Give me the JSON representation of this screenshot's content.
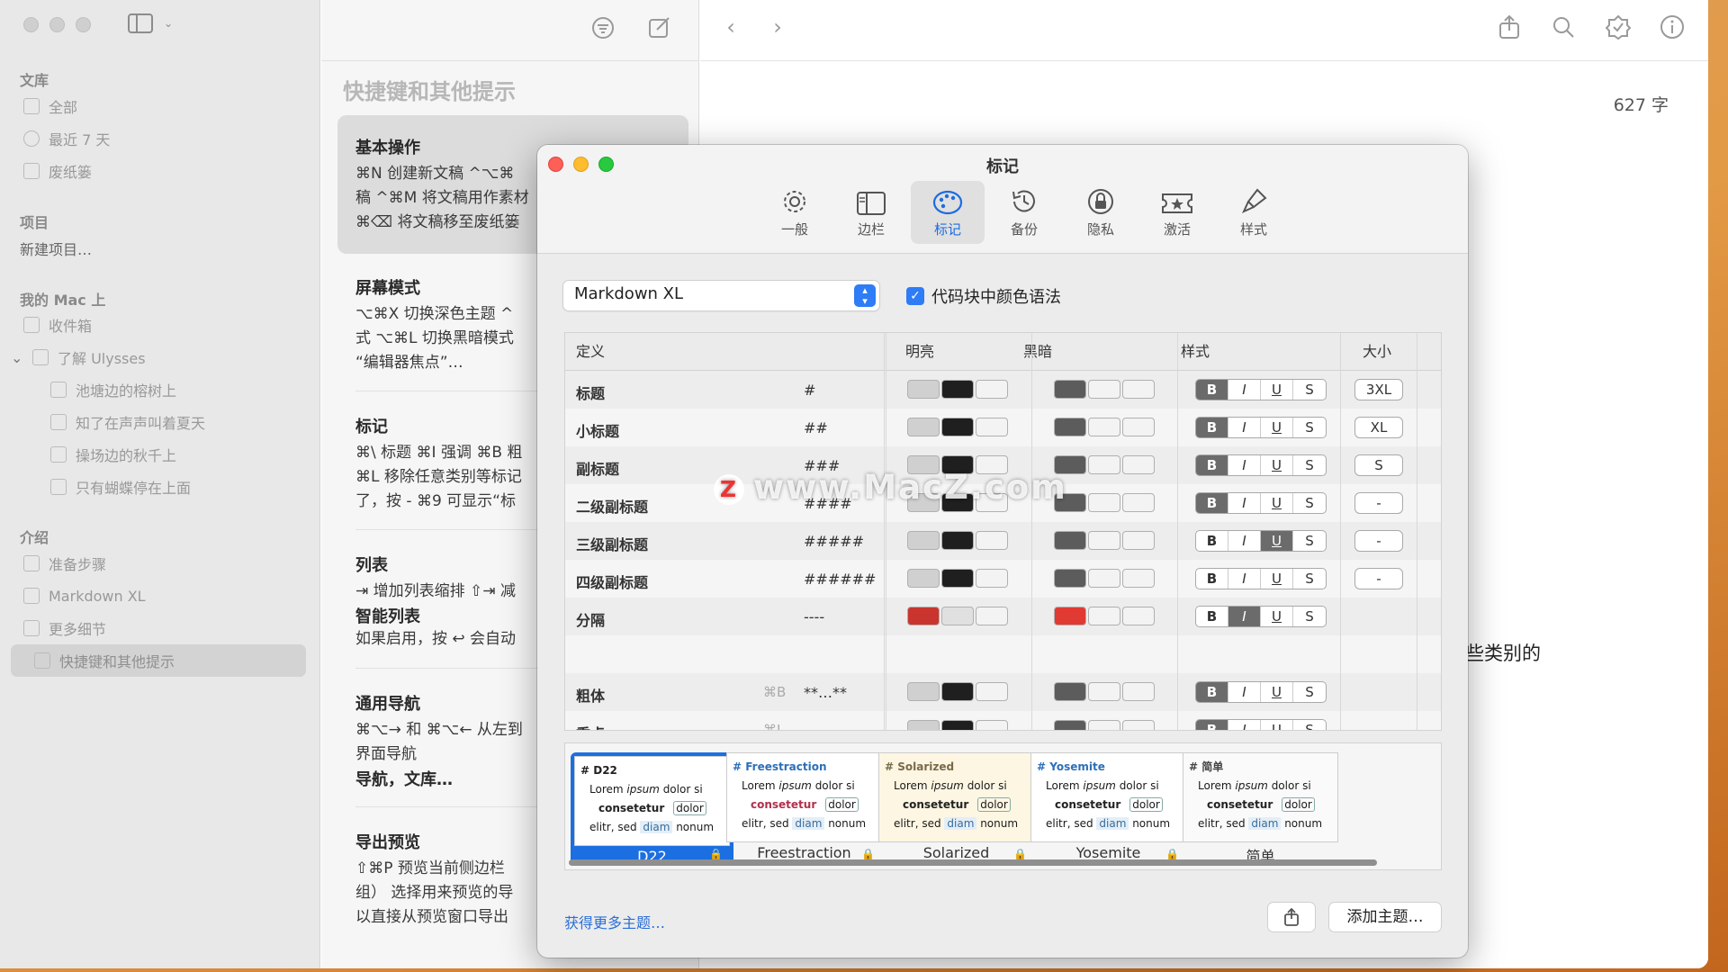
{
  "sidebar": {
    "library_header": "文库",
    "library": [
      {
        "label": "全部"
      },
      {
        "label": "最近 7 天"
      },
      {
        "label": "废纸篓"
      }
    ],
    "projects_header": "项目",
    "new_project": "新建项目…",
    "mac_header": "我的 Mac 上",
    "inbox": "收件箱",
    "learn_group": "了解 Ulysses",
    "learn_items": [
      {
        "label": "池塘边的榕树上"
      },
      {
        "label": "知了在声声叫着夏天"
      },
      {
        "label": "操场边的秋千上"
      },
      {
        "label": "只有蝴蝶停在上面"
      }
    ],
    "intro_header": "介绍",
    "intro_items": [
      {
        "label": "准备步骤"
      },
      {
        "label": "Markdown XL"
      },
      {
        "label": "更多细节"
      },
      {
        "label": "快捷键和其他提示"
      }
    ]
  },
  "list": {
    "title": "快捷键和其他提示",
    "cards": [
      {
        "heading": "基本操作",
        "lines": [
          "⌘N 创建新文稿 ^⌥⌘",
          "稿 ^⌘M 将文稿用作素材",
          "⌘⌫ 将文稿移至废纸篓"
        ]
      },
      {
        "heading": "屏幕模式",
        "lines": [
          "⌥⌘X 切换深色主题 ^",
          "式 ⌥⌘L 切换黑暗模式",
          "“编辑器焦点”…"
        ]
      },
      {
        "heading": "标记",
        "lines": [
          "⌘\\ 标题 ⌘I 强调 ⌘B 粗",
          "⌘L 移除任意类别等标记",
          "了，按 - ⌘9 可显示“标"
        ]
      },
      {
        "heading": "列表",
        "lines": [
          "⇥ 增加列表缩排 ⇧⇥ 减",
          "智能列表",
          "如果启用，按 ↩ 会自动"
        ]
      },
      {
        "heading": "通用导航",
        "lines": [
          "⌘⌥→ 和 ⌘⌥← 从左到",
          "界面导航",
          "导航，文库…"
        ]
      },
      {
        "heading": "导出预览",
        "lines": [
          "⇧⌘P 预览当前侧边栏",
          "组） 选择用来预览的导",
          "以直接从预览窗口导出"
        ]
      }
    ]
  },
  "editor": {
    "word_count": "627 字",
    "fragment": "些类别的"
  },
  "dialog": {
    "title": "标记",
    "tabs": [
      {
        "label": "一般",
        "icon": "gear-icon"
      },
      {
        "label": "边栏",
        "icon": "sidebar-icon"
      },
      {
        "label": "标记",
        "icon": "palette-icon"
      },
      {
        "label": "备份",
        "icon": "history-icon"
      },
      {
        "label": "隐私",
        "icon": "lock-icon"
      },
      {
        "label": "激活",
        "icon": "ticket-icon"
      },
      {
        "label": "样式",
        "icon": "brush-icon"
      }
    ],
    "markup_select": "Markdown XL",
    "syntax_color_label": "代码块中颜色语法",
    "syntax_color_checked": true,
    "columns": {
      "definition": "定义",
      "light": "明亮",
      "dark": "黑暗",
      "style": "样式",
      "size": "大小"
    },
    "rows": [
      {
        "name": "标题",
        "shortcut": "",
        "md": "#",
        "light": [
          "#d0d0d0",
          "#1f1f1f",
          "#f3f3f3"
        ],
        "dark": [
          "#5c5c5c",
          "#f3f3f3",
          "#f3f3f3"
        ],
        "style": [
          1,
          0,
          0,
          0
        ],
        "size": "3XL"
      },
      {
        "name": "小标题",
        "shortcut": "",
        "md": "##",
        "light": [
          "#d0d0d0",
          "#1f1f1f",
          "#f3f3f3"
        ],
        "dark": [
          "#5c5c5c",
          "#f3f3f3",
          "#f3f3f3"
        ],
        "style": [
          1,
          0,
          0,
          0
        ],
        "size": "XL"
      },
      {
        "name": "副标题",
        "shortcut": "",
        "md": "###",
        "light": [
          "#d0d0d0",
          "#1f1f1f",
          "#f3f3f3"
        ],
        "dark": [
          "#5c5c5c",
          "#f3f3f3",
          "#f3f3f3"
        ],
        "style": [
          1,
          0,
          0,
          0
        ],
        "size": "S"
      },
      {
        "name": "二级副标题",
        "shortcut": "",
        "md": "####",
        "light": [
          "#d0d0d0",
          "#1f1f1f",
          "#f3f3f3"
        ],
        "dark": [
          "#5c5c5c",
          "#f3f3f3",
          "#f3f3f3"
        ],
        "style": [
          1,
          0,
          0,
          0
        ],
        "size": "-"
      },
      {
        "name": "三级副标题",
        "shortcut": "",
        "md": "#####",
        "light": [
          "#d0d0d0",
          "#1f1f1f",
          "#f3f3f3"
        ],
        "dark": [
          "#5c5c5c",
          "#f3f3f3",
          "#f3f3f3"
        ],
        "style": [
          0,
          0,
          1,
          0
        ],
        "size": "-"
      },
      {
        "name": "四级副标题",
        "shortcut": "",
        "md": "######",
        "light": [
          "#d0d0d0",
          "#1f1f1f",
          "#f3f3f3"
        ],
        "dark": [
          "#5c5c5c",
          "#f3f3f3",
          "#f3f3f3"
        ],
        "style": [
          0,
          0,
          0,
          0
        ],
        "size": "-"
      },
      {
        "name": "分隔",
        "shortcut": "",
        "md": "----",
        "light": [
          "#c9352e",
          "#e0e0e0",
          "#f3f3f3"
        ],
        "dark": [
          "#e03a32",
          "#f3f3f3",
          "#f3f3f3"
        ],
        "style": [
          0,
          1,
          0,
          0
        ],
        "size": ""
      },
      {
        "name": "",
        "shortcut": "",
        "md": "",
        "light": [],
        "dark": [],
        "style": [],
        "size": ""
      },
      {
        "name": "粗体",
        "shortcut": "⌘B",
        "md": "**…**",
        "light": [
          "#d0d0d0",
          "#1f1f1f",
          "#f3f3f3"
        ],
        "dark": [
          "#5c5c5c",
          "#f3f3f3",
          "#f3f3f3"
        ],
        "style": [
          1,
          0,
          0,
          0
        ],
        "size": ""
      },
      {
        "name": "重点",
        "shortcut": "⌘I",
        "md": "",
        "light": [
          "#d0d0d0",
          "#1f1f1f",
          "#f3f3f3"
        ],
        "dark": [
          "#5c5c5c",
          "#f3f3f3",
          "#f3f3f3"
        ],
        "style": [
          1,
          0,
          0,
          0
        ],
        "size": ""
      }
    ],
    "style_buttons": [
      "B",
      "I",
      "U",
      "S"
    ],
    "themes": [
      {
        "title": "# D22",
        "name": "D22",
        "sel": true
      },
      {
        "title": "# Freestraction",
        "name": "Freestraction",
        "sel": false
      },
      {
        "title": "# Solarized",
        "name": "Solarized",
        "sel": false
      },
      {
        "title": "# Yosemite",
        "name": "Yosemite",
        "sel": false
      },
      {
        "title": "# 简单",
        "name": "简单",
        "sel": false
      }
    ],
    "theme_preview": {
      "line1_a": "Lorem ",
      "line1_b": "ipsum",
      "line1_c": " dolor si",
      "line2": "consetetur",
      "line2_b": "dolor",
      "line3": "elitr, sed ",
      "line3_b": "diam",
      "line3_c": " nonum"
    },
    "get_more": "获得更多主题…",
    "add_theme": "添加主题…"
  },
  "watermark": "www.MacZ.com",
  "watermark_logo": "Z"
}
